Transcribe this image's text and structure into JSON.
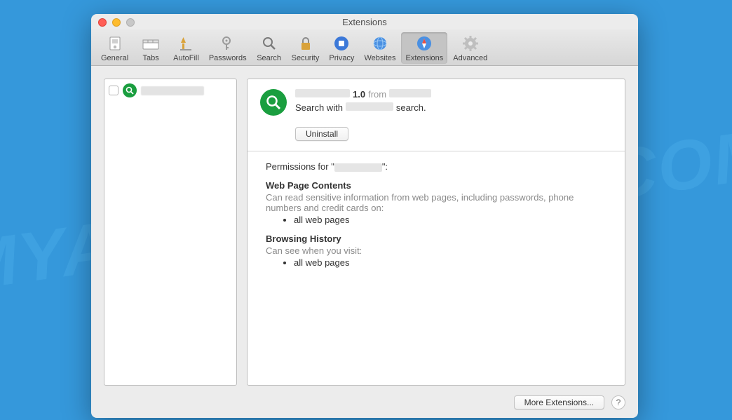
{
  "watermark": "MYANTISPYWARE.COM",
  "window": {
    "title": "Extensions"
  },
  "toolbar": {
    "tabs": [
      {
        "label": "General"
      },
      {
        "label": "Tabs"
      },
      {
        "label": "AutoFill"
      },
      {
        "label": "Passwords"
      },
      {
        "label": "Search"
      },
      {
        "label": "Security"
      },
      {
        "label": "Privacy"
      },
      {
        "label": "Websites"
      },
      {
        "label": "Extensions"
      },
      {
        "label": "Advanced"
      }
    ],
    "active_index": 8
  },
  "sidebar": {
    "items": [
      {
        "name_redacted": true,
        "checked": false
      }
    ]
  },
  "detail": {
    "name_redacted": true,
    "version": "1.0",
    "from_label": "from",
    "author_redacted": true,
    "description_prefix": "Search with",
    "description_mid_redacted": true,
    "description_suffix": "search.",
    "uninstall_label": "Uninstall",
    "permissions_label_prefix": "Permissions for \"",
    "permissions_name_redacted": true,
    "permissions_label_suffix": "\":",
    "sections": [
      {
        "title": "Web Page Contents",
        "desc": "Can read sensitive information from web pages, including passwords, phone numbers and credit cards on:",
        "items": [
          "all web pages"
        ]
      },
      {
        "title": "Browsing History",
        "desc": "Can see when you visit:",
        "items": [
          "all web pages"
        ]
      }
    ]
  },
  "footer": {
    "more_extensions": "More Extensions...",
    "help": "?"
  }
}
